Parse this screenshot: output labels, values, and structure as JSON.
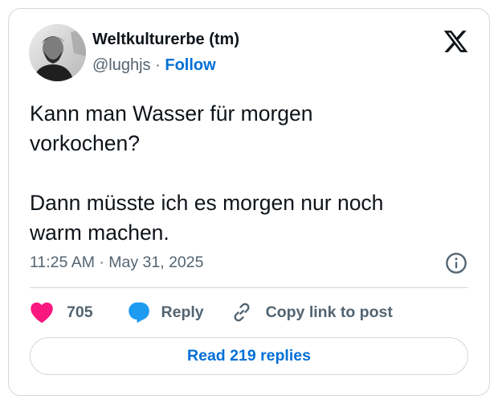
{
  "author": {
    "display_name": "Weltkulturerbe (tm)",
    "handle": "@lughjs",
    "separator": "·",
    "follow_label": "Follow"
  },
  "tweet": {
    "text": "Kann man Wasser für morgen\nvorkochen?\n\nDann müsste ich es morgen nur noch\nwarm machen.",
    "time": "11:25 AM",
    "separator": "·",
    "date": "May 31, 2025"
  },
  "actions": {
    "like_count": "705",
    "reply_label": "Reply",
    "copy_link_label": "Copy link to post"
  },
  "footer": {
    "read_replies_label": "Read 219 replies"
  },
  "colors": {
    "text": "#0f1419",
    "secondary": "#536471",
    "link_blue": "#006fd6",
    "like_pink": "#f91880",
    "reply_blue": "#1d9bf0",
    "border": "#cfd9de"
  },
  "icons": [
    "x-logo-icon",
    "info-icon",
    "heart-icon",
    "reply-bubble-icon",
    "link-icon"
  ]
}
